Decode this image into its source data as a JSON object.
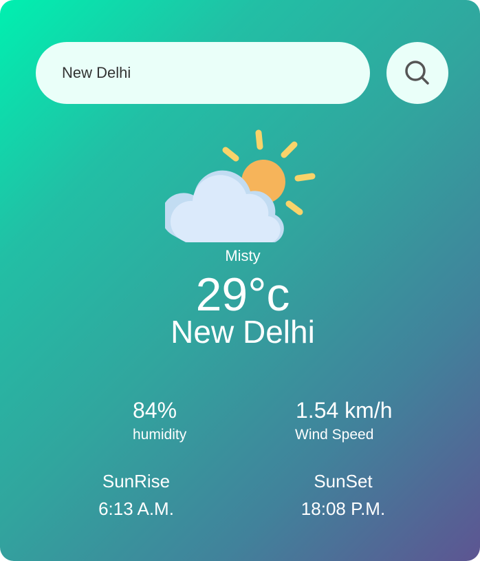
{
  "search": {
    "value": "New Delhi",
    "placeholder": ""
  },
  "search_button_icon": "search-icon",
  "weather": {
    "icon": "partly-cloudy-icon",
    "condition": "Misty",
    "temperature": "29°c",
    "city": "New Delhi",
    "humidity_value": "84%",
    "humidity_label": "humidity",
    "wind_value": "1.54 km/h",
    "wind_label": "Wind Speed",
    "sunrise_label": "SunRise",
    "sunrise_time": "6:13 A.M.",
    "sunset_label": "SunSet",
    "sunset_time": "18:08 P.M."
  },
  "colors": {
    "gradient_start": "#00f0b0",
    "gradient_end": "#5d5592",
    "input_background": "#eafff9",
    "sun": "#f6b45a",
    "sun_rays": "#f9d36a",
    "cloud": "#dbeafb"
  }
}
